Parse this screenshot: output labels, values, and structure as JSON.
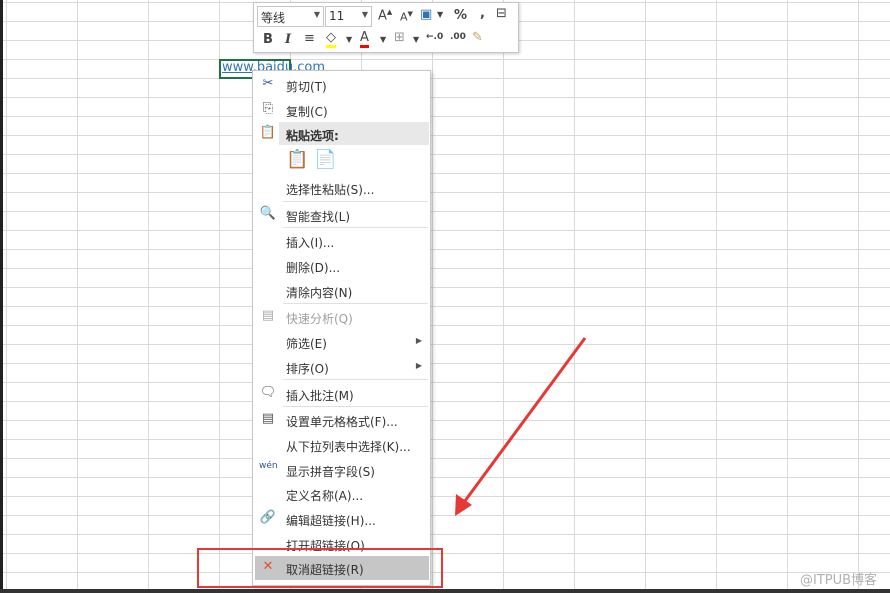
{
  "cell": {
    "text": "www.baidu.com"
  },
  "mini_toolbar": {
    "font": "等线",
    "size": "11",
    "bold": "B",
    "italic": "I",
    "percent": "%",
    "comma": ","
  },
  "menu": {
    "items": [
      {
        "label": "剪切(T)",
        "icon": "scissors-icon"
      },
      {
        "label": "复制(C)",
        "icon": "copy-icon"
      },
      {
        "label": "粘贴选项:",
        "icon": "paste-icon"
      },
      {
        "label": "选择性粘贴(S)..."
      },
      {
        "label": "智能查找(L)",
        "icon": "smart-lookup-icon"
      },
      {
        "label": "插入(I)..."
      },
      {
        "label": "删除(D)..."
      },
      {
        "label": "清除内容(N)"
      },
      {
        "label": "快速分析(Q)",
        "icon": "quick-analysis-icon"
      },
      {
        "label": "筛选(E)"
      },
      {
        "label": "排序(O)"
      },
      {
        "label": "插入批注(M)",
        "icon": "comment-icon"
      },
      {
        "label": "设置单元格格式(F)...",
        "icon": "format-cells-icon"
      },
      {
        "label": "从下拉列表中选择(K)..."
      },
      {
        "label": "显示拼音字段(S)",
        "icon": "phonetic-icon"
      },
      {
        "label": "定义名称(A)..."
      },
      {
        "label": "编辑超链接(H)...",
        "icon": "edit-link-icon"
      },
      {
        "label": "打开超链接(O)"
      },
      {
        "label": "取消超链接(R)",
        "icon": "remove-link-icon"
      }
    ]
  },
  "watermark": "@ITPUB博客",
  "colors": {
    "highlight": "#ffff00",
    "font_color": "#ff0000",
    "annotation": "#e53935"
  }
}
